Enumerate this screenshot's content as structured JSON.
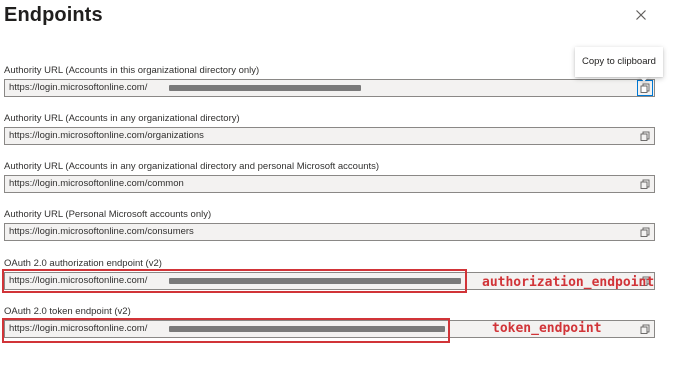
{
  "panel": {
    "title": "Endpoints",
    "close_icon": "close-icon"
  },
  "tooltip": {
    "text": "Copy to clipboard"
  },
  "endpoints": [
    {
      "label": "Authority URL (Accounts in this organizational directory only)",
      "value": "https://login.microsoftonline.com/",
      "redacted": true
    },
    {
      "label": "Authority URL (Accounts in any organizational directory)",
      "value": "https://login.microsoftonline.com/organizations",
      "redacted": false
    },
    {
      "label": "Authority URL (Accounts in any organizational directory and personal Microsoft accounts)",
      "value": "https://login.microsoftonline.com/common",
      "redacted": false
    },
    {
      "label": "Authority URL (Personal Microsoft accounts only)",
      "value": "https://login.microsoftonline.com/consumers",
      "redacted": false
    },
    {
      "label": "OAuth 2.0 authorization endpoint (v2)",
      "value": "https://login.microsoftonline.com/",
      "redacted": true
    },
    {
      "label": "OAuth 2.0 token endpoint (v2)",
      "value": "https://login.microsoftonline.com/",
      "redacted": true
    }
  ],
  "annotations": {
    "authorization": "authorization_endpoint",
    "token": "token_endpoint",
    "color": "#d13438"
  },
  "colors": {
    "field_background": "#f3f2f1",
    "field_border": "#8a8886",
    "focus_accent": "#0078d4",
    "redaction": "#7a7a7a"
  }
}
